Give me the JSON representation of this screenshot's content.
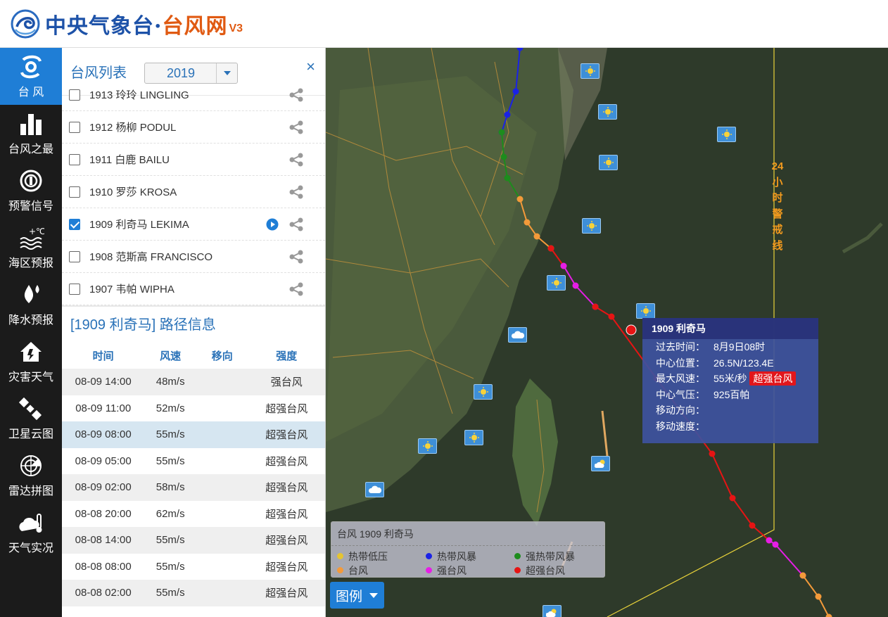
{
  "header": {
    "logo_main": "中央气象台·",
    "logo_sub": "台风网",
    "version": "V3"
  },
  "nav": [
    {
      "label": "台 风",
      "icon": "typhoon-icon",
      "active": true
    },
    {
      "label": "台风之最",
      "icon": "bar-chart-icon"
    },
    {
      "label": "预警信号",
      "icon": "warning-signal-icon"
    },
    {
      "label": "海区预报",
      "icon": "sea-temperature-icon"
    },
    {
      "label": "降水预报",
      "icon": "raindrop-icon"
    },
    {
      "label": "灾害天气",
      "icon": "house-hazard-icon"
    },
    {
      "label": "卫星云图",
      "icon": "satellite-icon"
    },
    {
      "label": "雷达拼图",
      "icon": "radar-icon"
    },
    {
      "label": "天气实况",
      "icon": "thermometer-cloud-icon"
    }
  ],
  "panel": {
    "title": "台风列表",
    "year": "2019",
    "close": "×"
  },
  "typhoons": [
    {
      "label": "1913 玲玲 LINGLING",
      "checked": false
    },
    {
      "label": "1912 杨柳 PODUL",
      "checked": false
    },
    {
      "label": "1911 白鹿 BAILU",
      "checked": false
    },
    {
      "label": "1910 罗莎 KROSA",
      "checked": false
    },
    {
      "label": "1909 利奇马 LEKIMA",
      "checked": true
    },
    {
      "label": "1908 范斯高 FRANCISCO",
      "checked": false
    },
    {
      "label": "1907 韦帕 WIPHA",
      "checked": false
    }
  ],
  "track": {
    "title": "[1909 利奇马] 路径信息",
    "headers": [
      "时间",
      "风速",
      "移向",
      "强度"
    ],
    "rows": [
      [
        "08-09 14:00",
        "48m/s",
        "",
        "强台风"
      ],
      [
        "08-09 11:00",
        "52m/s",
        "",
        "超强台风"
      ],
      [
        "08-09 08:00",
        "55m/s",
        "",
        "超强台风"
      ],
      [
        "08-09 05:00",
        "55m/s",
        "",
        "超强台风"
      ],
      [
        "08-09 02:00",
        "58m/s",
        "",
        "超强台风"
      ],
      [
        "08-08 20:00",
        "62m/s",
        "",
        "超强台风"
      ],
      [
        "08-08 14:00",
        "55m/s",
        "",
        "超强台风"
      ],
      [
        "08-08 08:00",
        "55m/s",
        "",
        "超强台风"
      ],
      [
        "08-08 02:00",
        "55m/s",
        "",
        "超强台风"
      ]
    ],
    "selected_row": 2
  },
  "popup": {
    "title": "1909 利奇马",
    "rows": [
      {
        "k": "过去时间：",
        "v": "8月9日08时"
      },
      {
        "k": "中心位置：",
        "v": "26.5N/123.4E"
      },
      {
        "k": "最大风速：",
        "v": "55米/秒",
        "badge": "超强台风"
      },
      {
        "k": "中心气压：",
        "v": "925百帕"
      },
      {
        "k": "移动方向：",
        "v": ""
      },
      {
        "k": "移动速度：",
        "v": ""
      }
    ]
  },
  "map": {
    "warning_line_24h": "24小时警戒线"
  },
  "legend": {
    "header": "台风   1909 利奇马",
    "items": [
      {
        "label": "热带低压",
        "color": "#e5c432"
      },
      {
        "label": "热带风暴",
        "color": "#1a22e6"
      },
      {
        "label": "强热带风暴",
        "color": "#1d8c1d"
      },
      {
        "label": "台风",
        "color": "#f39a3a"
      },
      {
        "label": "强台风",
        "color": "#e61ee6"
      },
      {
        "label": "超强台风",
        "color": "#e61414"
      }
    ],
    "button": "图例"
  }
}
